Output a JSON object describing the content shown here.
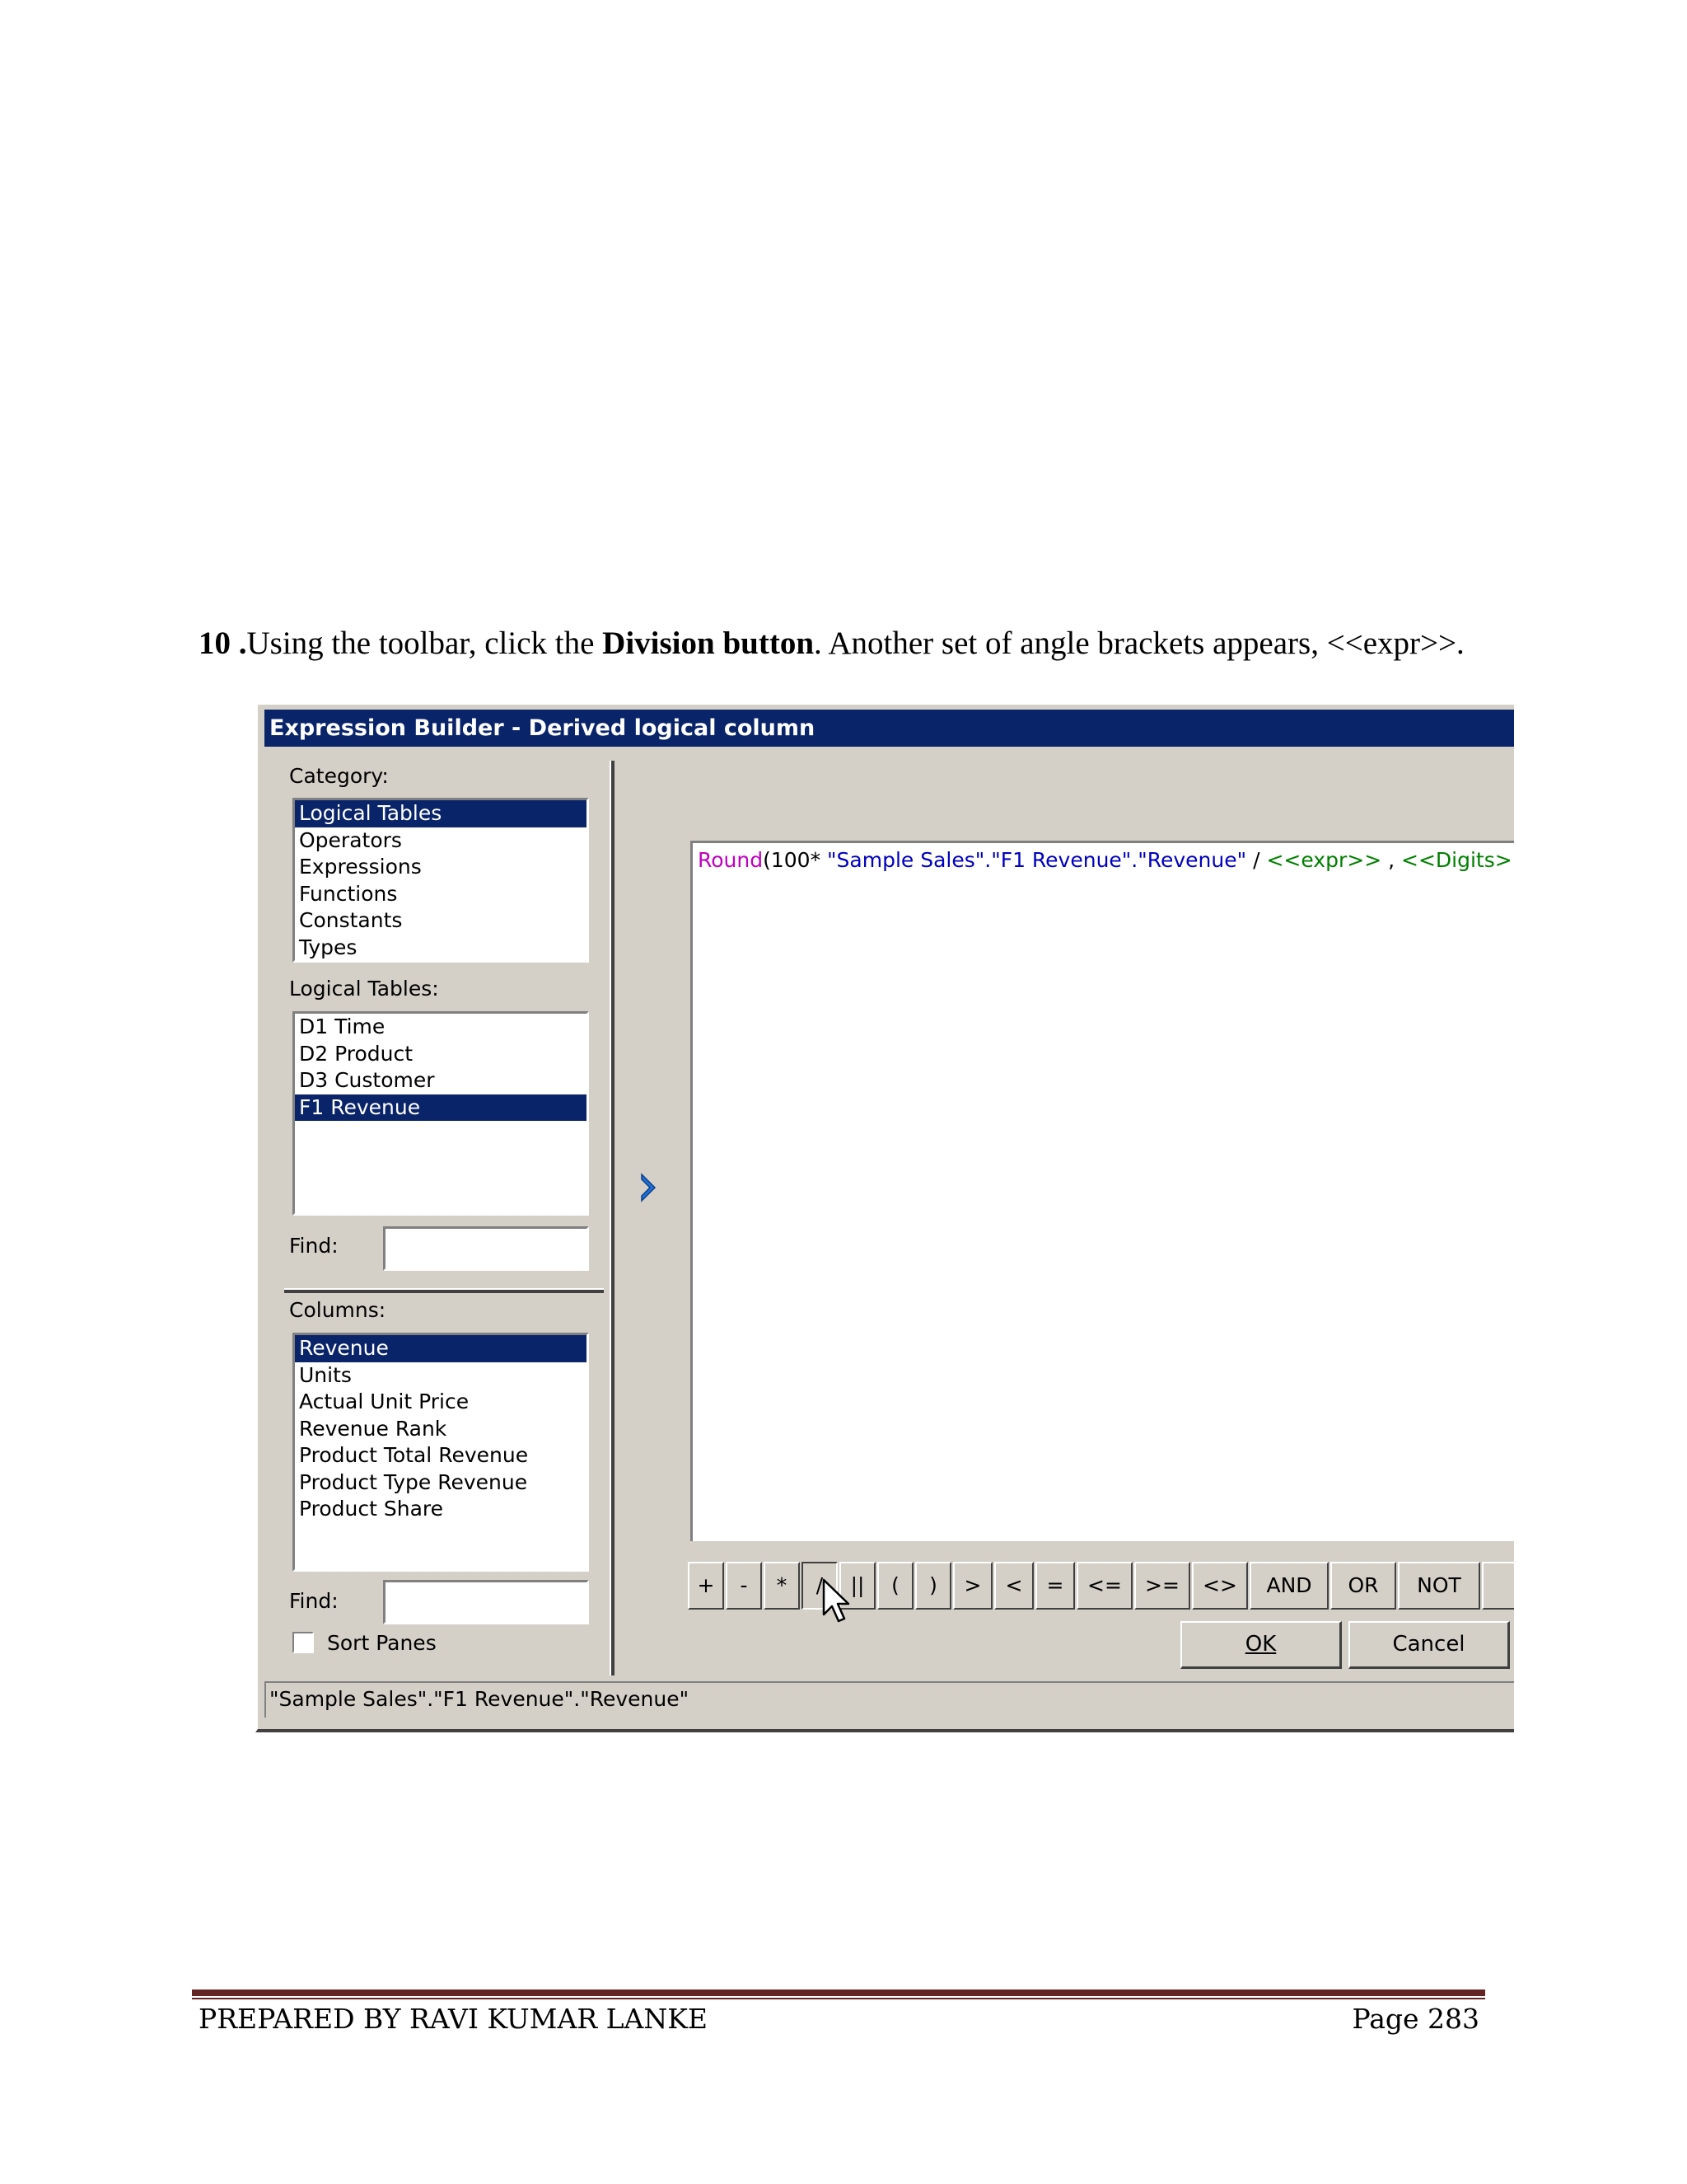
{
  "step": {
    "number": "10 .",
    "text_before": "Using the toolbar, click the ",
    "bold": "Division button",
    "text_after": ". Another set of angle brackets appears, <<expr>>."
  },
  "dialog": {
    "title": "Expression Builder - Derived logical column",
    "category_label": "Category:",
    "categories": [
      "Logical Tables",
      "Operators",
      "Expressions",
      "Functions",
      "Constants",
      "Types"
    ],
    "logical_tables_label": "Logical Tables:",
    "logical_tables": [
      "D1 Time",
      "D2 Product",
      "D3 Customer",
      "F1 Revenue"
    ],
    "find_label": "Find:",
    "columns_label": "Columns:",
    "columns": [
      "Revenue",
      "Units",
      "Actual Unit Price",
      "Revenue Rank",
      "Product Total Revenue",
      "Product Type Revenue",
      "Product Share"
    ],
    "sort_panes_label": "Sort Panes",
    "expression": {
      "fn": "Round",
      "p1": "(100* ",
      "p2": "\"Sample Sales\".\"F1 Revenue\".\"Revenue\"",
      "p3": " / ",
      "p4": "<<expr>>",
      "p5": " , ",
      "p6": "<<Digits>>",
      "p7": ")"
    },
    "operators": [
      "+",
      "-",
      "*",
      "/",
      "||",
      "(",
      ")",
      ">",
      "<",
      "=",
      "<=",
      ">=",
      "<>",
      "AND",
      "OR",
      "NOT"
    ],
    "ok_label": "OK",
    "cancel_label": "Cancel",
    "status_text": "\"Sample Sales\".\"F1 Revenue\".\"Revenue\""
  },
  "footer": {
    "left": "PREPARED BY RAVI KUMAR LANKE",
    "right": "Page 283"
  },
  "colors": {
    "titlebar": "#0a246a",
    "dialog_bg": "#d4d0c8",
    "function": "#c000c0",
    "identifier": "#0000c0",
    "placeholder": "#008000",
    "footer_rule": "#632523"
  }
}
